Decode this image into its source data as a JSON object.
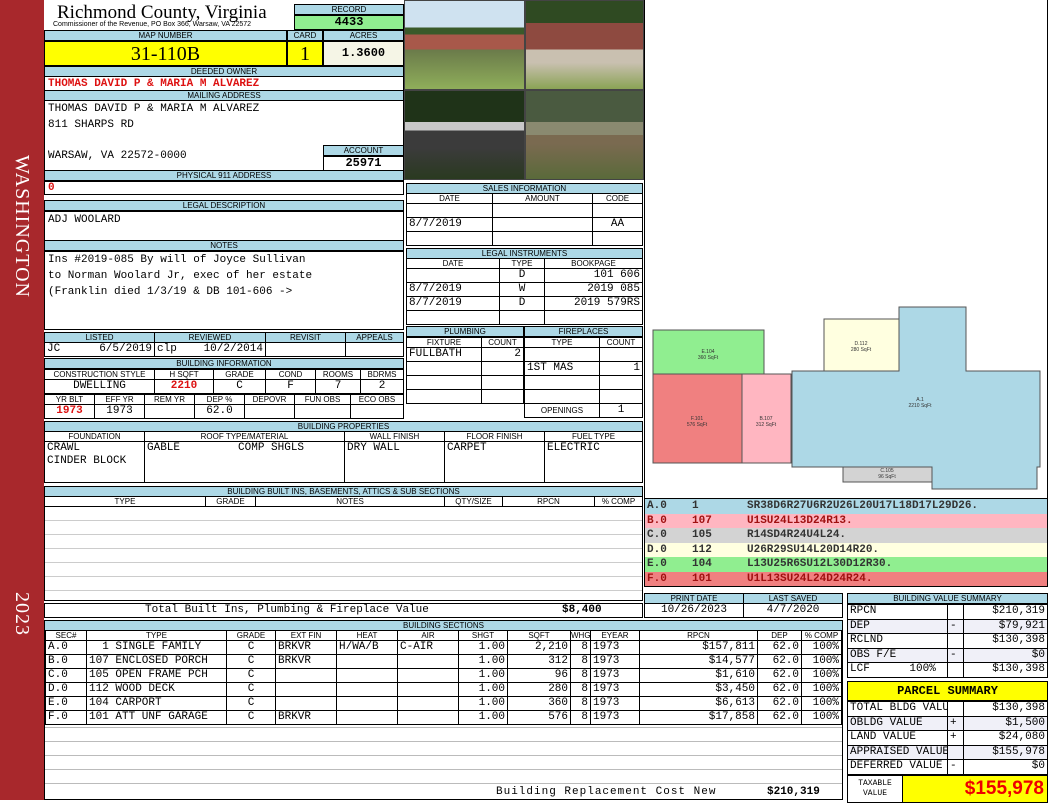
{
  "sidebar": {
    "district": "WASHINGTON",
    "year": "2023",
    "color": "#a8282c"
  },
  "header": {
    "title": "Richmond County, Virginia",
    "subtitle": "Commissioner of the Revenue, PO Box 366, Warsaw, VA 22572",
    "record_label": "RECORD",
    "record": "4433"
  },
  "parcel": {
    "map_label": "MAP NUMBER",
    "map_number": "31-110B",
    "card_label": "CARD",
    "card": "1",
    "acres_label": "ACRES",
    "acres": "1.3600"
  },
  "owner": {
    "label": "DEEDED OWNER",
    "name": "THOMAS DAVID P & MARIA M ALVAREZ"
  },
  "mailing": {
    "label": "MAILING ADDRESS",
    "line1": "THOMAS DAVID P & MARIA M ALVAREZ",
    "line2": "811 SHARPS RD",
    "line3": "WARSAW, VA 22572-0000",
    "account_label": "ACCOUNT",
    "account": "25971"
  },
  "physical": {
    "label": "PHYSICAL 911 ADDRESS",
    "value": "0"
  },
  "legal": {
    "label": "LEGAL DESCRIPTION",
    "value": "ADJ WOOLARD"
  },
  "notes": {
    "label": "NOTES",
    "lines": [
      "Ins #2019-085 By will of Joyce Sullivan",
      "to Norman Woolard Jr, exec of her estate",
      "(Franklin died 1/3/19 & DB 101-606 ->"
    ]
  },
  "listing": {
    "headers": [
      "LISTED",
      "REVIEWED",
      "REVISIT",
      "APPEALS"
    ],
    "listed_by": "JC",
    "listed_date": "6/5/2019",
    "reviewed_by": "clp",
    "reviewed_date": "10/2/2014"
  },
  "building_info": {
    "label": "BUILDING INFORMATION",
    "headers1": [
      "CONSTRUCTION STYLE",
      "H SQFT",
      "GRADE",
      "COND",
      "ROOMS",
      "BDRMS"
    ],
    "values1": [
      "DWELLING",
      "2210",
      "C",
      "F",
      "7",
      "2"
    ],
    "headers2": [
      "YR BLT",
      "EFF YR",
      "REM YR",
      "DEP %",
      "DEPOVR",
      "FUN OBS",
      "ECO OBS"
    ],
    "values2": [
      "1973",
      "1973",
      "",
      "62.0",
      "",
      "",
      ""
    ]
  },
  "sales": {
    "label": "SALES INFORMATION",
    "headers": [
      "DATE",
      "AMOUNT",
      "CODE"
    ],
    "rows": [
      [
        "",
        "",
        ""
      ],
      [
        "8/7/2019",
        "",
        "AA"
      ],
      [
        "",
        "",
        ""
      ]
    ]
  },
  "instruments": {
    "label": "LEGAL INSTRUMENTS",
    "headers": [
      "DATE",
      "TYPE",
      "BOOKPAGE"
    ],
    "rows": [
      [
        "",
        "D",
        "101 606"
      ],
      [
        "8/7/2019",
        "W",
        "2019 085"
      ],
      [
        "8/7/2019",
        "D",
        "2019 579RS"
      ],
      [
        "",
        "",
        ""
      ]
    ]
  },
  "plumbing": {
    "label": "PLUMBING",
    "headers": [
      "FIXTURE",
      "COUNT"
    ],
    "rows": [
      [
        "FULLBATH",
        "2"
      ],
      [
        "",
        ""
      ],
      [
        "",
        ""
      ],
      [
        "",
        ""
      ]
    ]
  },
  "fireplaces": {
    "label": "FIREPLACES",
    "headers": [
      "TYPE",
      "COUNT"
    ],
    "rows": [
      [
        "",
        ""
      ],
      [
        "1ST MAS",
        "1"
      ],
      [
        "",
        ""
      ],
      [
        "",
        ""
      ]
    ],
    "openings_label": "OPENINGS",
    "openings": "1"
  },
  "properties": {
    "label": "BUILDING PROPERTIES",
    "headers": [
      "FOUNDATION",
      "ROOF TYPE/MATERIAL",
      "WALL FINISH",
      "FLOOR FINISH",
      "FUEL TYPE"
    ],
    "foundation": [
      "CRAWL",
      "CINDER BLOCK"
    ],
    "roof_type": "GABLE",
    "roof_material": "COMP SHGLS",
    "wall": "DRY WALL",
    "floor": "CARPET",
    "fuel": "ELECTRIC"
  },
  "builtins": {
    "label": "BUILDING BUILT INS, BASEMENTS, ATTICS & SUB SECTIONS",
    "headers": [
      "TYPE",
      "GRADE",
      "NOTES",
      "QTY/SIZE",
      "RPCN",
      "% COMP"
    ],
    "total_label": "Total Built Ins, Plumbing & Fireplace Value",
    "total": "$8,400"
  },
  "dates": {
    "print_label": "PRINT DATE",
    "print": "10/26/2023",
    "saved_label": "LAST SAVED",
    "saved": "4/7/2020"
  },
  "sections": {
    "label": "BUILDING SECTIONS",
    "headers": [
      "SEC#",
      "TYPE",
      "GRADE",
      "EXT FIN",
      "HEAT",
      "AIR",
      "SHGT",
      "SQFT",
      "WHGT",
      "EYEAR",
      "RPCN",
      "DEP",
      "% COMP"
    ],
    "rows": [
      [
        "A.0",
        "  1 SINGLE FAMILY",
        "C",
        "BRKVR",
        "H/WA/B",
        "C-AIR",
        "1.00",
        "2,210",
        "8",
        "1973",
        "$157,811",
        "62.0",
        "100%"
      ],
      [
        "B.0",
        "107 ENCLOSED PORCH",
        "C",
        "BRKVR",
        "",
        "",
        "1.00",
        "312",
        "8",
        "1973",
        "$14,577",
        "62.0",
        "100%"
      ],
      [
        "C.0",
        "105 OPEN FRAME PCH",
        "C",
        "",
        "",
        "",
        "1.00",
        "96",
        "8",
        "1973",
        "$1,610",
        "62.0",
        "100%"
      ],
      [
        "D.0",
        "112 WOOD DECK",
        "C",
        "",
        "",
        "",
        "1.00",
        "280",
        "8",
        "1973",
        "$3,450",
        "62.0",
        "100%"
      ],
      [
        "E.0",
        "104 CARPORT",
        "C",
        "",
        "",
        "",
        "1.00",
        "360",
        "8",
        "1973",
        "$6,613",
        "62.0",
        "100%"
      ],
      [
        "F.0",
        "101 ATT UNF GARAGE",
        "C",
        "BRKVR",
        "",
        "",
        "1.00",
        "576",
        "8",
        "1973",
        "$17,858",
        "62.0",
        "100%"
      ]
    ],
    "replacement_label": "Building Replacement Cost New",
    "replacement": "$210,319"
  },
  "sketch": {
    "labels": [
      [
        "A.1",
        "2210 SqFt"
      ],
      [
        "B.107",
        "312 SqFt"
      ],
      [
        "C.105",
        "96 SqFt"
      ],
      [
        "D.112",
        "280 SqFt"
      ],
      [
        "E.104",
        "360 SqFt"
      ],
      [
        "F.101",
        "576 SqFt"
      ]
    ],
    "legend": [
      [
        "A.0",
        "1",
        "SR38D6R27U6R2U26L20U17L18D17L29D26.",
        "#add8e6"
      ],
      [
        "B.0",
        "107",
        "U1SU24L13D24R13.",
        "#ffb6c1"
      ],
      [
        "C.0",
        "105",
        "R14SD4R24U4L24.",
        "#d3d3d3"
      ],
      [
        "D.0",
        "112",
        "U26R29SU14L20D14R20.",
        "#ffffe0"
      ],
      [
        "E.0",
        "104",
        "L13U25R6SU12L30D12R30.",
        "#90ee90"
      ],
      [
        "F.0",
        "101",
        "U1L13SU24L24D24R24.",
        "#f08080"
      ]
    ]
  },
  "value_summary": {
    "label": "BUILDING VALUE SUMMARY",
    "rows": [
      [
        "RPCN",
        "",
        "$210,319"
      ],
      [
        "DEP",
        "-",
        "$79,921"
      ],
      [
        "RCLND",
        "",
        "$130,398"
      ],
      [
        "OBS F/E",
        "-",
        "$0"
      ],
      [
        "LCF      100%",
        "",
        "$130,398"
      ]
    ]
  },
  "parcel_summary": {
    "label": "PARCEL SUMMARY",
    "rows": [
      [
        "TOTAL BLDG VALUE",
        "",
        "$130,398"
      ],
      [
        "OBLDG VALUE",
        "+",
        "$1,500"
      ],
      [
        "LAND VALUE",
        "+",
        "$24,080"
      ],
      [
        "APPRAISED VALUE",
        "",
        "$155,978"
      ],
      [
        "DEFERRED VALUE",
        "-",
        "$0"
      ]
    ],
    "taxable_label": "TAXABLE VALUE",
    "taxable": "$155,978"
  }
}
